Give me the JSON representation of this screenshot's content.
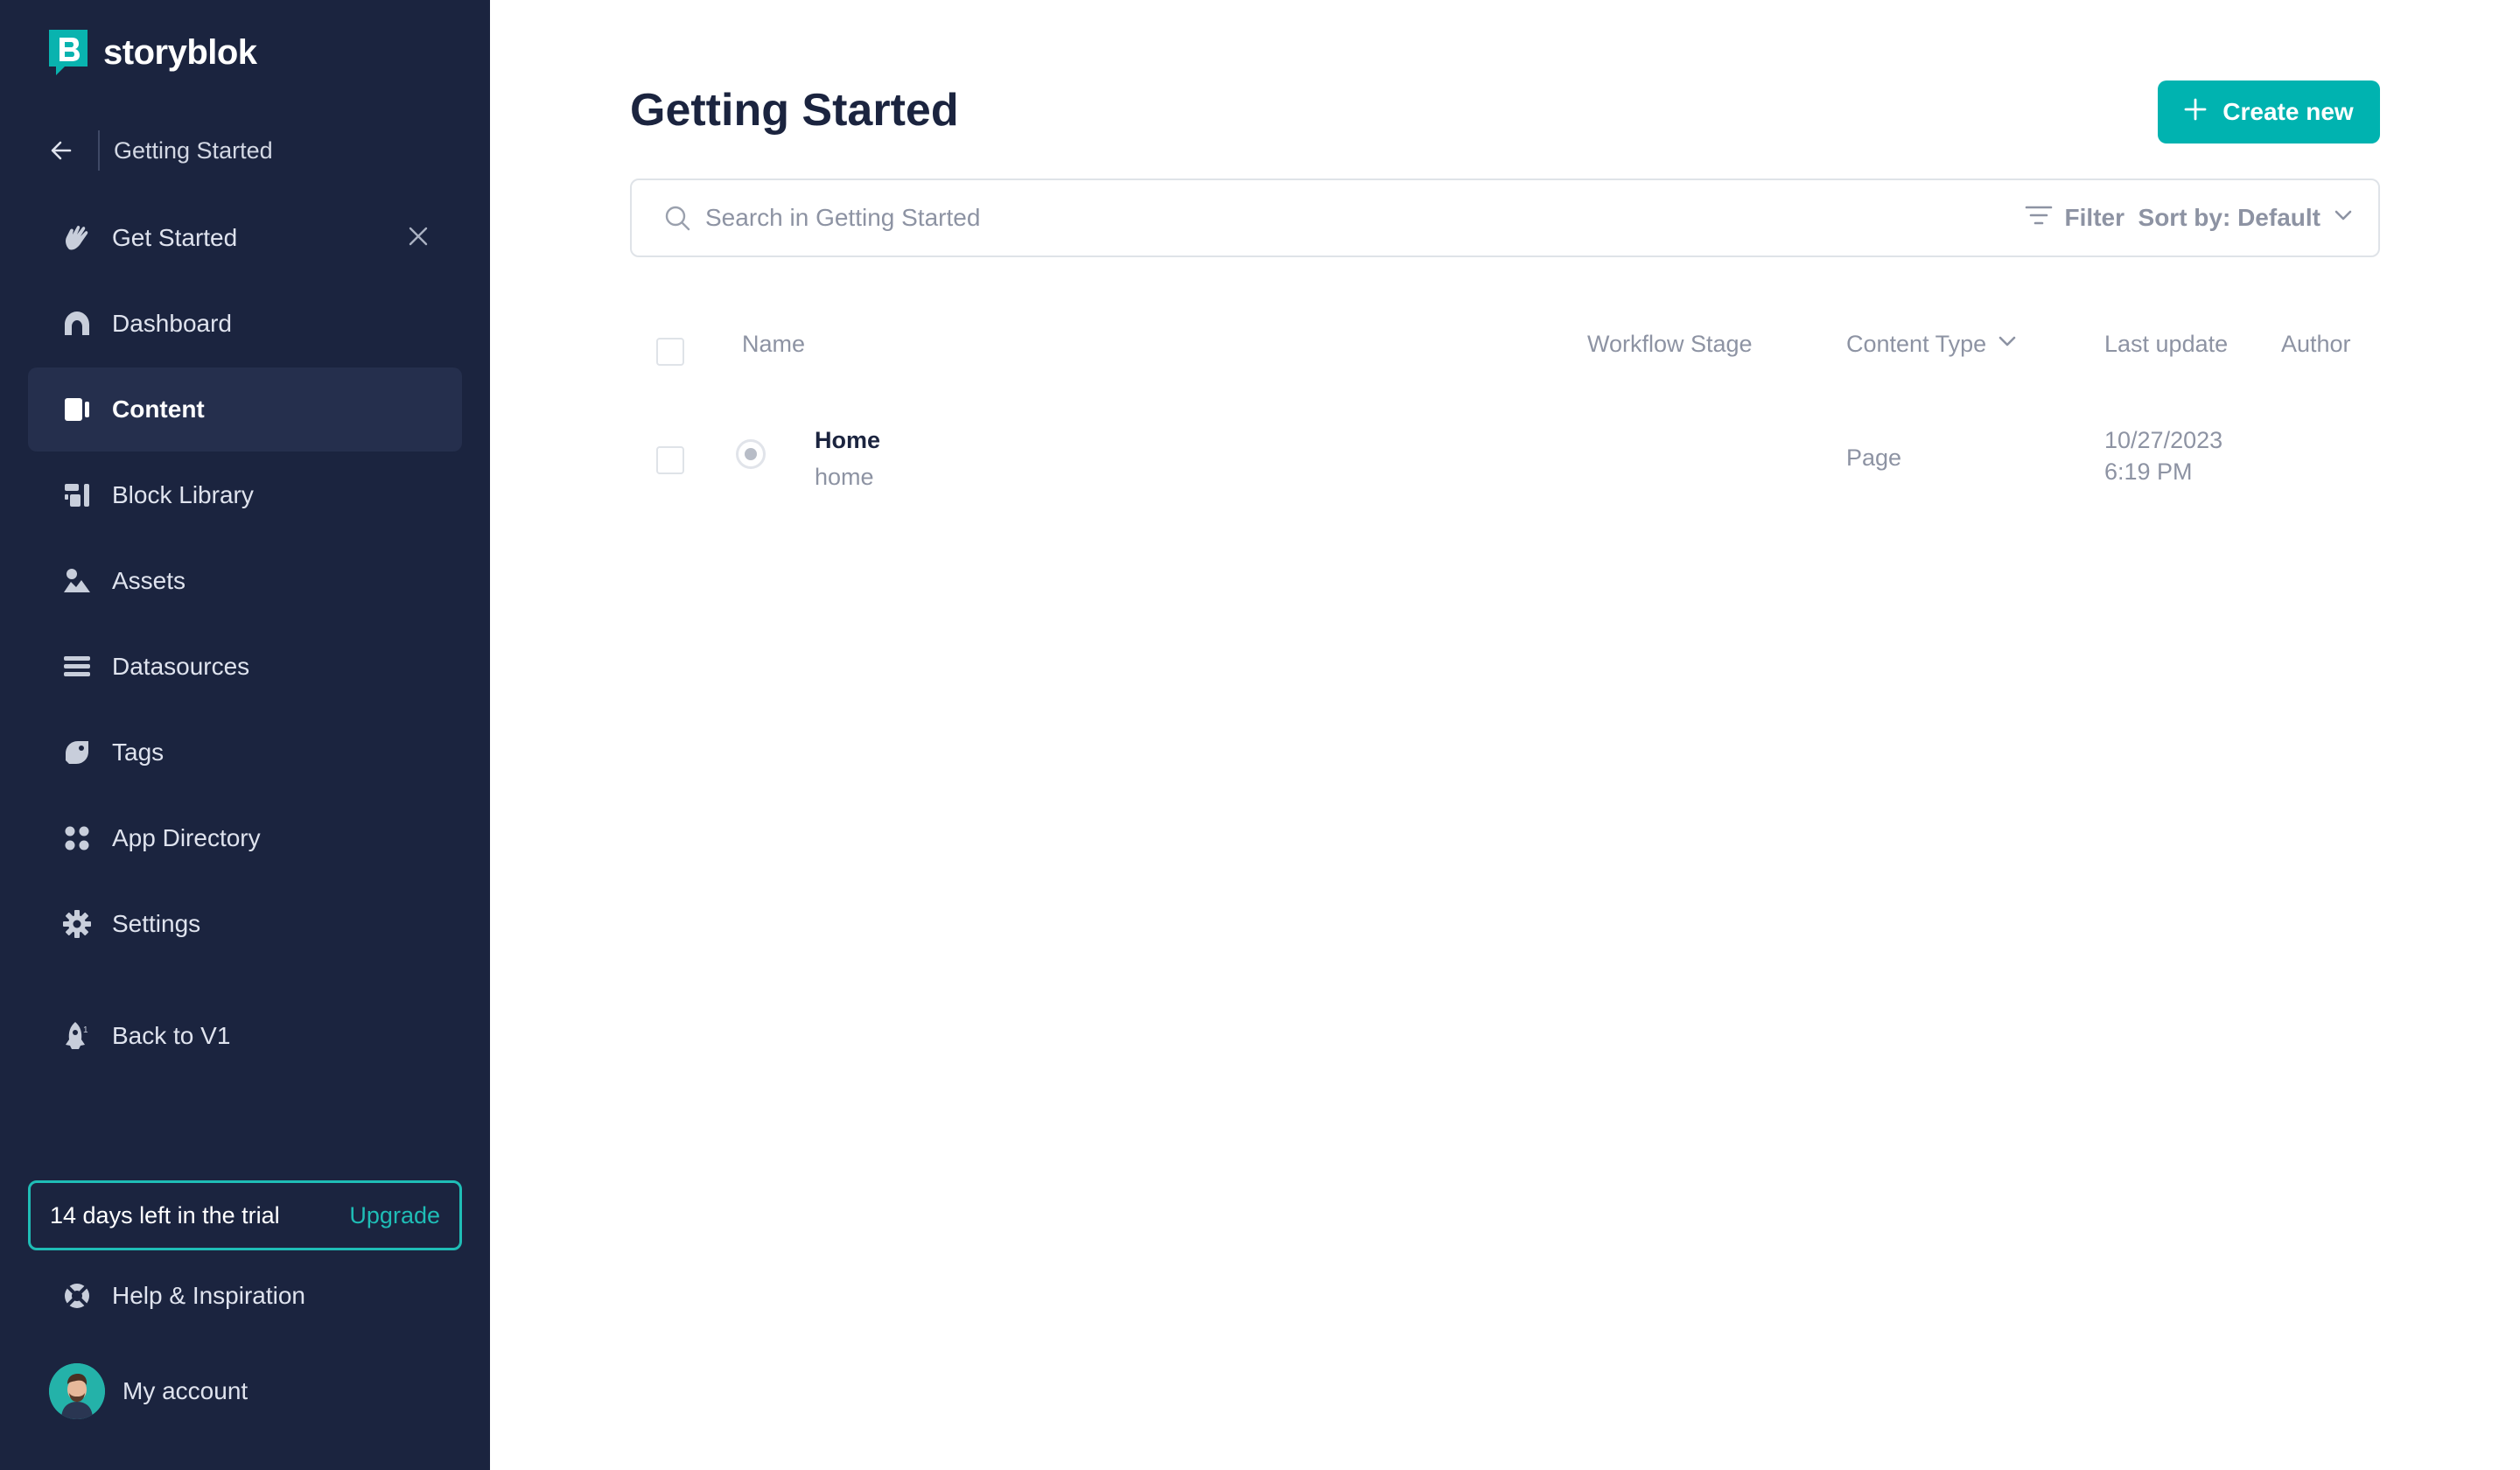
{
  "brand": {
    "name": "storyblok"
  },
  "sidebar": {
    "space_name": "Getting Started",
    "items": [
      {
        "label": "Get Started",
        "icon": "wave-hand-icon"
      },
      {
        "label": "Dashboard",
        "icon": "dashboard-icon"
      },
      {
        "label": "Content",
        "icon": "content-icon",
        "active": true
      },
      {
        "label": "Block Library",
        "icon": "block-library-icon"
      },
      {
        "label": "Assets",
        "icon": "assets-icon"
      },
      {
        "label": "Datasources",
        "icon": "datasources-icon"
      },
      {
        "label": "Tags",
        "icon": "tag-icon"
      },
      {
        "label": "App Directory",
        "icon": "app-directory-icon"
      },
      {
        "label": "Settings",
        "icon": "gear-icon"
      },
      {
        "label": "Back to V1",
        "icon": "rocket-icon"
      }
    ],
    "trial": {
      "text": "14 days left in the trial",
      "cta": "Upgrade"
    },
    "help": "Help & Inspiration",
    "account": "My account"
  },
  "main": {
    "title": "Getting Started",
    "create_button": "Create new",
    "search": {
      "placeholder": "Search in Getting Started"
    },
    "filter_label": "Filter",
    "sort_label": "Sort by: Default",
    "table": {
      "columns": [
        "Name",
        "Workflow Stage",
        "Content Type",
        "Last update",
        "Author"
      ],
      "rows": [
        {
          "name": "Home",
          "slug": "home",
          "workflow_stage": "",
          "content_type": "Page",
          "last_update_date": "10/27/2023",
          "last_update_time": "6:19 PM",
          "author": ""
        }
      ]
    }
  },
  "colors": {
    "sidebar_bg": "#1b243f",
    "accent": "#00b3b0",
    "text_dark": "#1b243f",
    "text_muted": "#8d93a3"
  }
}
